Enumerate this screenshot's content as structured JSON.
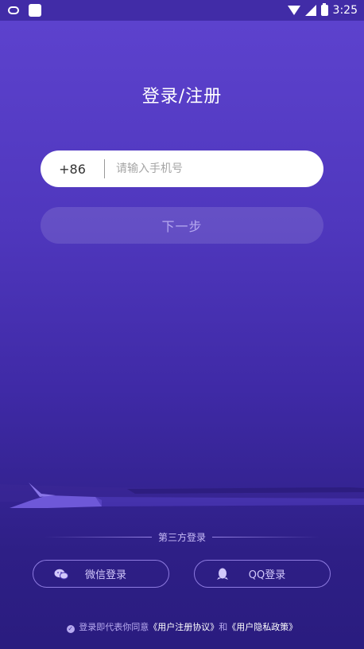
{
  "status_bar": {
    "time": "3:25",
    "icons": [
      "cloud-icon",
      "app-square-icon",
      "wifi-icon",
      "signal-icon",
      "battery-icon"
    ]
  },
  "title": "登录/注册",
  "phone": {
    "country_code": "+86",
    "placeholder": "请输入手机号",
    "value": ""
  },
  "next_button": "下一步",
  "third_party": {
    "label": "第三方登录",
    "wechat": {
      "label": "微信登录",
      "icon": "wechat-icon"
    },
    "qq": {
      "label": "QQ登录",
      "icon": "qq-icon"
    }
  },
  "agreement": {
    "prefix": "登录即代表你同意",
    "user_agreement": "《用户注册协议》",
    "and": "和",
    "privacy_policy": "《用户隐私政策》"
  },
  "colors": {
    "bg_top": "#5e43cf",
    "bg_bottom": "#2a1c7f",
    "input_bg": "#ffffff",
    "button_text": "#b5a8ef"
  }
}
